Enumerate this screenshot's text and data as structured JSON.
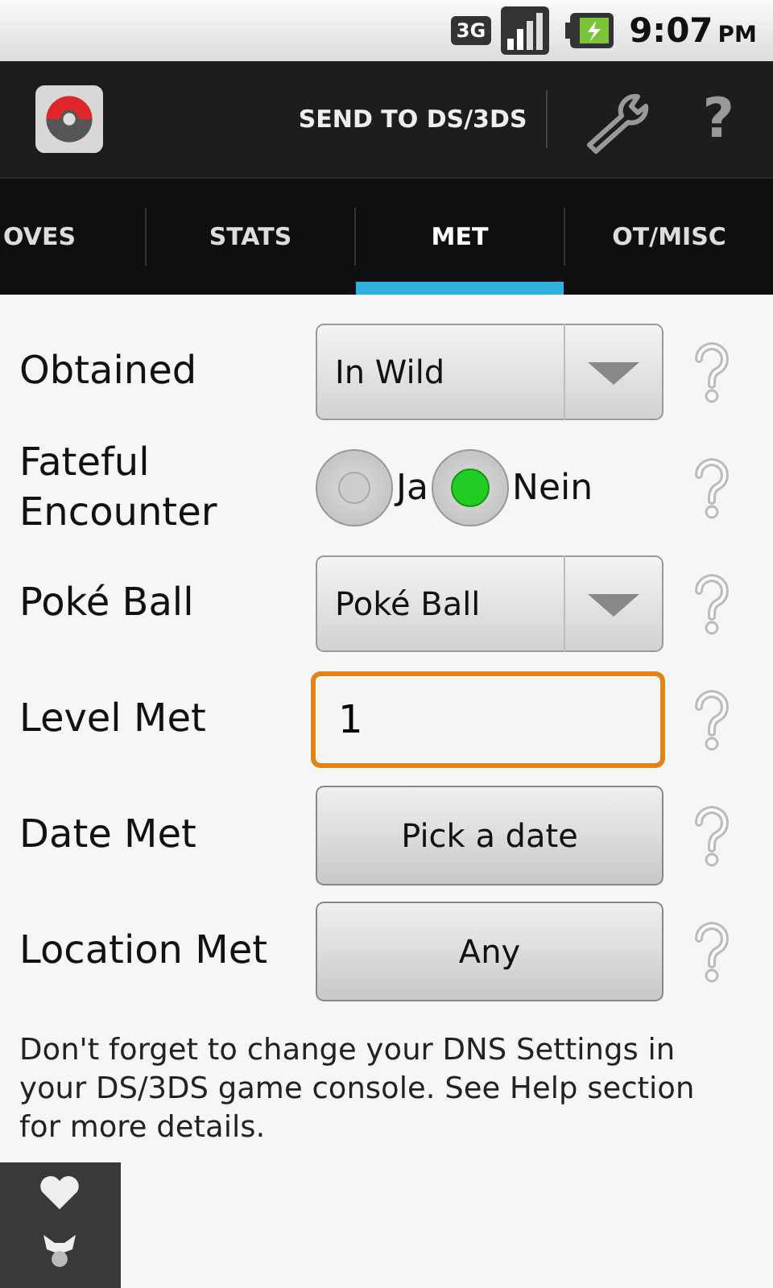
{
  "status_bar": {
    "network": "3G",
    "time": "9:07",
    "ampm": "PM"
  },
  "action_bar": {
    "send_label": "SEND TO DS/3DS",
    "help": "?"
  },
  "tabs": [
    {
      "label": "OVES",
      "selected": false
    },
    {
      "label": "STATS",
      "selected": false
    },
    {
      "label": "MET",
      "selected": true
    },
    {
      "label": "OT/MISC",
      "selected": false
    }
  ],
  "rows": [
    {
      "kind": "dropdown",
      "label": "Obtained",
      "value": "In Wild"
    },
    {
      "kind": "radio",
      "label": "Fateful Encounter",
      "options": [
        {
          "label": "Ja",
          "selected": false
        },
        {
          "label": "Nein",
          "selected": true
        }
      ]
    },
    {
      "kind": "dropdown",
      "label": "Poké Ball",
      "value": "Poké Ball"
    },
    {
      "kind": "input",
      "label": "Level Met",
      "value": "1",
      "focused": true
    },
    {
      "kind": "button",
      "label": "Date Met",
      "value": "Pick a date"
    },
    {
      "kind": "button",
      "label": "Location Met",
      "value": "Any"
    }
  ],
  "note": "Don't forget to change your DNS Settings in your DS/3DS game console. See Help section for more details."
}
